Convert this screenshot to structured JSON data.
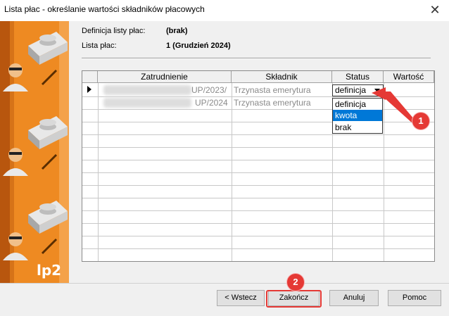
{
  "window": {
    "title": "Lista płac - określanie wartości składników płacowych"
  },
  "banner": {
    "logo": "lp2"
  },
  "info": {
    "definition_label": "Definicja listy płac:",
    "definition_value": "(brak)",
    "list_label": "Lista płac:",
    "list_value": "1 (Grudzień 2024)"
  },
  "grid": {
    "columns": [
      "Zatrudnienie",
      "Składnik",
      "Status",
      "Wartość"
    ],
    "rows": [
      {
        "employment": "UP/2023/",
        "component": "Trzynasta emerytura",
        "status": "definicja"
      },
      {
        "employment": "UP/2024",
        "component": "Trzynasta emerytura",
        "status": ""
      }
    ]
  },
  "dropdown": {
    "options": [
      "definicja",
      "kwota",
      "brak"
    ],
    "selected": "kwota"
  },
  "buttons": {
    "back": "< Wstecz",
    "finish": "Zakończ",
    "cancel": "Anuluj",
    "help": "Pomoc"
  },
  "callouts": {
    "first": "1",
    "second": "2"
  },
  "colors": {
    "banner": "#ee8a22",
    "selection": "#0078d7",
    "callout": "#e53935"
  }
}
